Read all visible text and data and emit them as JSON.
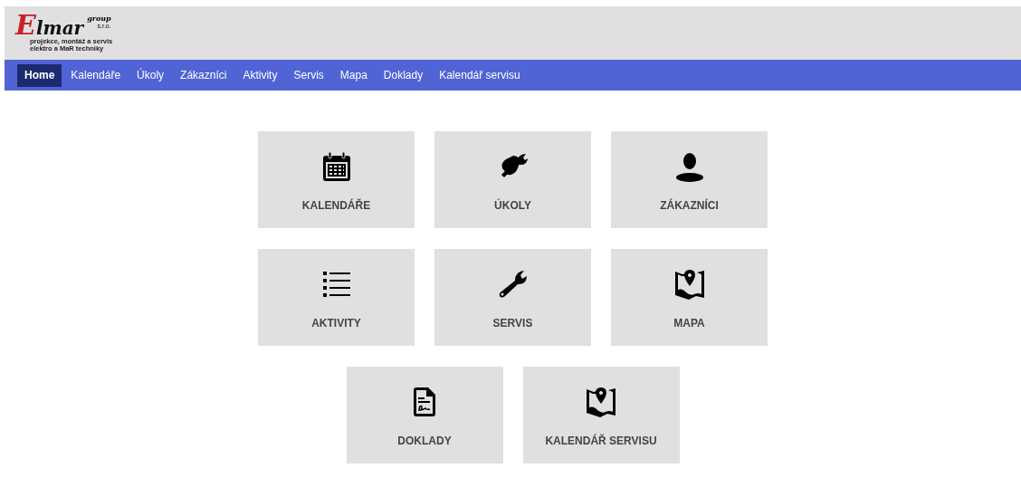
{
  "logo": {
    "name": "Elmar",
    "group": "group",
    "suffix": "s.r.o.",
    "tagline": [
      "projekce, montáž a servis",
      "elektro a MaR techniky"
    ]
  },
  "nav": [
    {
      "label": "Home",
      "selected": true
    },
    {
      "label": "Kalendáře",
      "selected": false
    },
    {
      "label": "Úkoly",
      "selected": false
    },
    {
      "label": "Zákazníci",
      "selected": false
    },
    {
      "label": "Aktivity",
      "selected": false
    },
    {
      "label": "Servis",
      "selected": false
    },
    {
      "label": "Mapa",
      "selected": false
    },
    {
      "label": "Doklady",
      "selected": false
    },
    {
      "label": "Kalendář servisu",
      "selected": false
    }
  ],
  "tiles": [
    [
      {
        "label": "KALENDÁŘE",
        "kind": "calendar"
      },
      {
        "label": "ÚKOLY",
        "kind": "plug"
      },
      {
        "label": "ZÁKAZNÍCI",
        "kind": "person"
      }
    ],
    [
      {
        "label": "AKTIVITY",
        "kind": "list"
      },
      {
        "label": "SERVIS",
        "kind": "wrench"
      },
      {
        "label": "MAPA",
        "kind": "map"
      }
    ],
    [
      {
        "label": "DOKLADY",
        "kind": "document"
      },
      {
        "label": "KALENDÁŘ SERVISU",
        "kind": "map"
      }
    ]
  ]
}
